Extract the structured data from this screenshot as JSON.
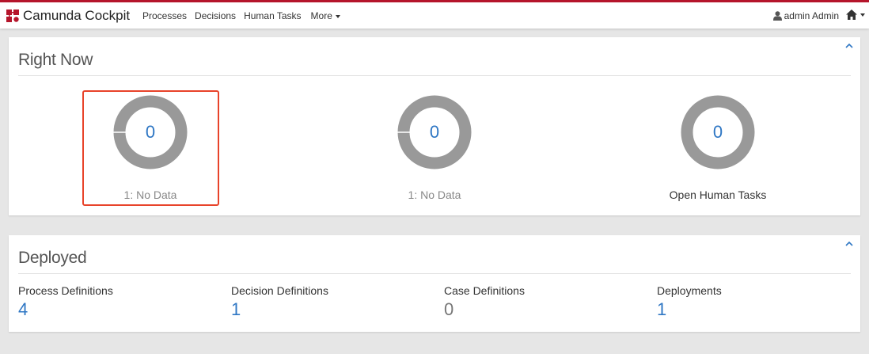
{
  "brand": {
    "name": "Camunda Cockpit",
    "accent": "#b5152b"
  },
  "nav": {
    "items": [
      "Processes",
      "Decisions",
      "Human Tasks",
      "More"
    ]
  },
  "user": {
    "name": "admin Admin",
    "icon": "user-icon"
  },
  "home": {
    "icon": "home-icon"
  },
  "right_now": {
    "title": "Right Now",
    "widgets": [
      {
        "value": "0",
        "label": "1: No Data",
        "highlighted": true
      },
      {
        "value": "0",
        "label": "1: No Data",
        "highlighted": false
      },
      {
        "value": "0",
        "label": "Open Human Tasks",
        "highlighted": false
      }
    ]
  },
  "deployed": {
    "title": "Deployed",
    "stats": [
      {
        "label": "Process Definitions",
        "value": "4",
        "color": "#2f77c4"
      },
      {
        "label": "Decision Definitions",
        "value": "1",
        "color": "#2f77c4"
      },
      {
        "label": "Case Definitions",
        "value": "0",
        "color": "#777777"
      },
      {
        "label": "Deployments",
        "value": "1",
        "color": "#2f77c4"
      }
    ]
  },
  "colors": {
    "donut": "#999999",
    "highlight": "#e8432a",
    "link": "#2f77c4"
  }
}
